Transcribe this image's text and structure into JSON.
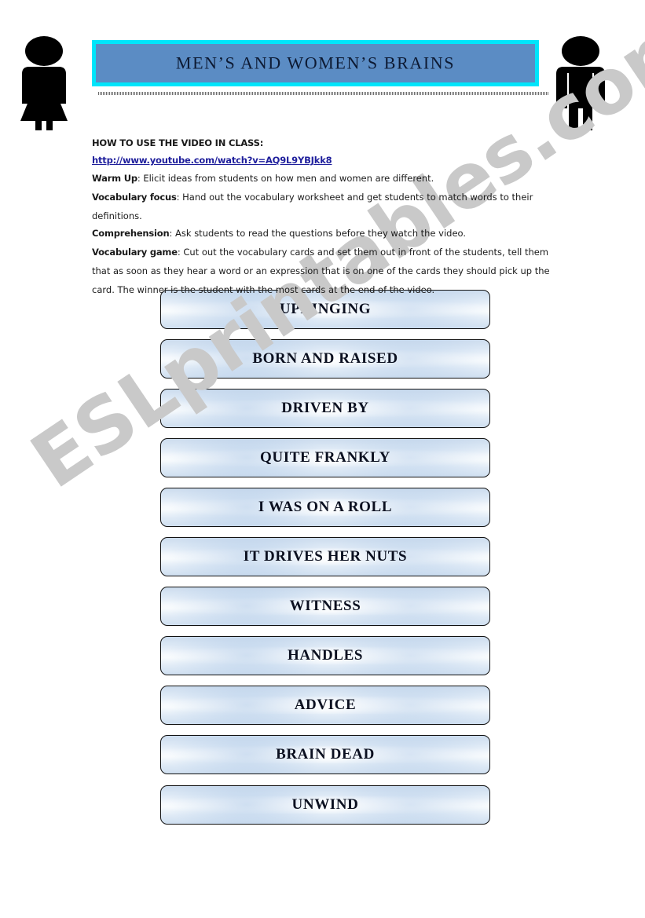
{
  "page": {
    "title_banner": {
      "text": "MEN’S AND WOMEN’S BRAINS",
      "fill_color": "#5b8cc4",
      "border_color": "#00e5fb"
    },
    "figures": {
      "left_icon": "female-pictogram-icon",
      "right_icon": "male-pictogram-icon"
    },
    "watermark": {
      "text": "ESLprintables.com",
      "color": "#c9c9c9"
    }
  },
  "instructions": {
    "heading": "HOW TO USE THE VIDEO IN CLASS:",
    "url": "http://www.youtube.com/watch?v=AQ9L9YBJkk8",
    "url_color": "#1f1f9c",
    "items": [
      {
        "label": "Warm Up",
        "separator": ":",
        "text": "  Elicit ideas from students on how men and women are different."
      },
      {
        "label": "Vocabulary focus",
        "separator": ":",
        "text": " Hand out the vocabulary worksheet and get students to match words to their definitions."
      },
      {
        "label": "Comprehension",
        "separator": ":",
        "text": " Ask students to read the questions before they watch the video."
      },
      {
        "label": "Vocabulary game",
        "separator": ":",
        "text": " Cut out the vocabulary cards and set them out in front of the students, tell them that as soon as they hear a word or an expression that is on one of the cards they should pick up the card. The winner is the student with the most cards at the end of the video."
      }
    ]
  },
  "vocabulary_cards": [
    {
      "label": "UPRINGING"
    },
    {
      "label": "BORN AND RAISED"
    },
    {
      "label": "DRIVEN BY"
    },
    {
      "label": "QUITE FRANKLY"
    },
    {
      "label": "I WAS ON A ROLL"
    },
    {
      "label": "IT DRIVES HER NUTS"
    },
    {
      "label": "WITNESS"
    },
    {
      "label": "HANDLES"
    },
    {
      "label": "ADVICE"
    },
    {
      "label": "BRAIN DEAD"
    },
    {
      "label": "UNWIND"
    }
  ]
}
